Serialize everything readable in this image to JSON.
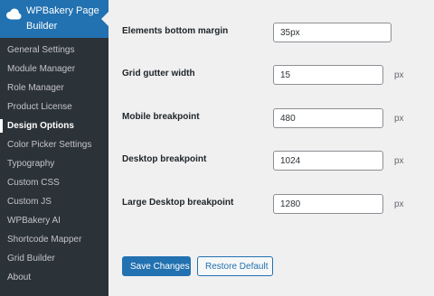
{
  "sidebar": {
    "brand": "WPBakery Page Builder",
    "items": [
      {
        "label": "General Settings"
      },
      {
        "label": "Module Manager"
      },
      {
        "label": "Role Manager"
      },
      {
        "label": "Product License"
      },
      {
        "label": "Design Options",
        "active": true
      },
      {
        "label": "Color Picker Settings"
      },
      {
        "label": "Typography"
      },
      {
        "label": "Custom CSS"
      },
      {
        "label": "Custom JS"
      },
      {
        "label": "WPBakery AI"
      },
      {
        "label": "Shortcode Mapper"
      },
      {
        "label": "Grid Builder"
      },
      {
        "label": "About"
      }
    ]
  },
  "form": {
    "rows": [
      {
        "label": "Elements bottom margin",
        "value": "35px",
        "unit": ""
      },
      {
        "label": "Grid gutter width",
        "value": "15",
        "unit": "px"
      },
      {
        "label": "Mobile breakpoint",
        "value": "480",
        "unit": "px"
      },
      {
        "label": "Desktop breakpoint",
        "value": "1024",
        "unit": "px"
      },
      {
        "label": "Large Desktop breakpoint",
        "value": "1280",
        "unit": "px"
      }
    ]
  },
  "actions": {
    "save_label": "Save Changes",
    "restore_label": "Restore Default"
  },
  "colors": {
    "accent": "#2271b1",
    "sidebar_bg": "#2c3338",
    "page_bg": "#f0f0f1"
  },
  "icons": {
    "brand": "cloud-icon"
  }
}
